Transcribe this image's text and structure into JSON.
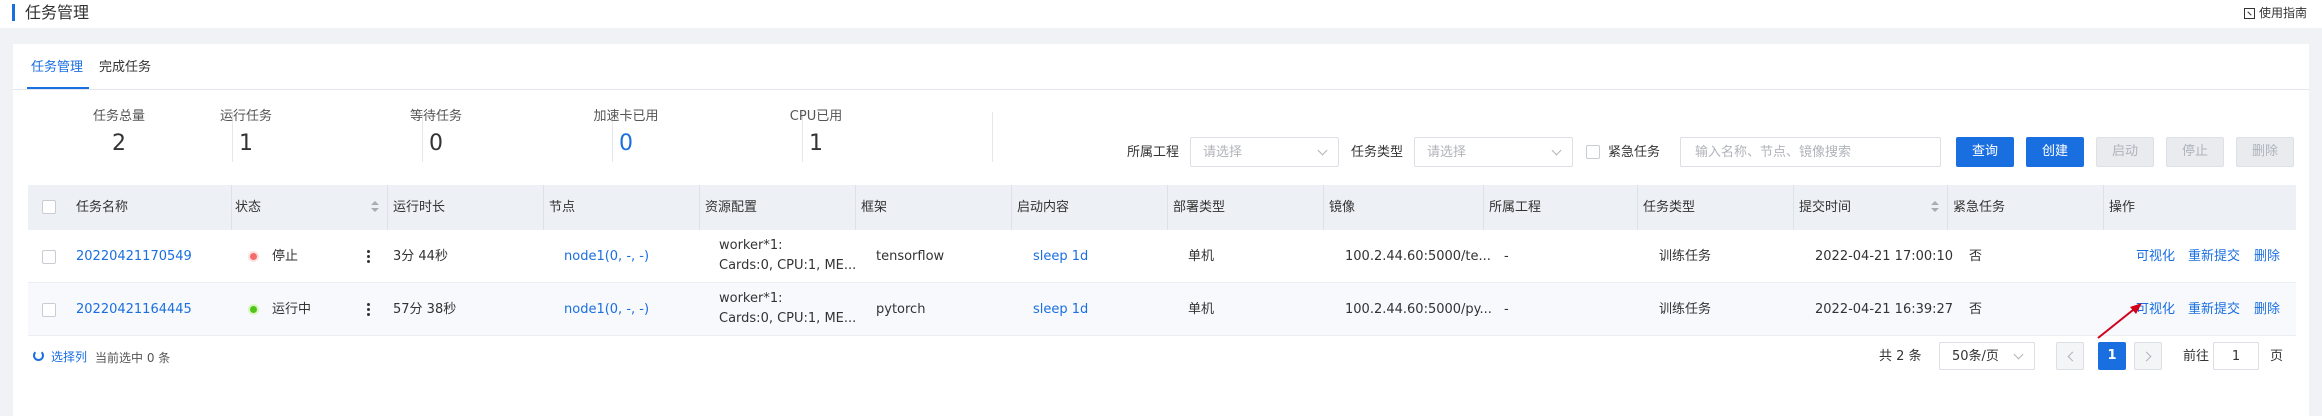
{
  "header": {
    "title": "任务管理",
    "guide_label": "使用指南"
  },
  "tabs": [
    {
      "label": "任务管理",
      "active": true
    },
    {
      "label": "完成任务",
      "active": false
    }
  ],
  "stats": [
    {
      "label": "任务总量",
      "value": "2"
    },
    {
      "label": "运行任务",
      "value": "1"
    },
    {
      "label": "等待任务",
      "value": "0"
    },
    {
      "label": "加速卡已用",
      "value": "0"
    },
    {
      "label": "CPU已用",
      "value": "1"
    }
  ],
  "filters": {
    "project_label": "所属工程",
    "project_placeholder": "请选择",
    "type_label": "任务类型",
    "type_placeholder": "请选择",
    "urgent_label": "紧急任务",
    "search_placeholder": "输入名称、节点、镜像搜索"
  },
  "buttons": {
    "query": "查询",
    "create": "创建",
    "start": "启动",
    "stop": "停止",
    "delete": "删除"
  },
  "table": {
    "columns": [
      "任务名称",
      "状态",
      "运行时长",
      "节点",
      "资源配置",
      "框架",
      "启动内容",
      "部署类型",
      "镜像",
      "所属工程",
      "任务类型",
      "提交时间",
      "紧急任务",
      "操作"
    ],
    "rows": [
      {
        "name": "20220421170549",
        "status": "停止",
        "duration": "3分 44秒",
        "node": "node1(0, -, -)",
        "res_line1": "worker*1:",
        "res_line2": "Cards:0, CPU:1, ME...",
        "framework": "tensorflow",
        "start_content": "sleep 1d",
        "deploy_type": "单机",
        "image": "100.2.44.60:5000/te...",
        "project": "-",
        "task_type": "训练任务",
        "submit_time": "2022-04-21 17:00:10",
        "urgent": "否",
        "actions": [
          "可视化",
          "重新提交",
          "删除"
        ]
      },
      {
        "name": "20220421164445",
        "status": "运行中",
        "duration": "57分 38秒",
        "node": "node1(0, -, -)",
        "res_line1": "worker*1:",
        "res_line2": "Cards:0, CPU:1, ME...",
        "framework": "pytorch",
        "start_content": "sleep 1d",
        "deploy_type": "单机",
        "image": "100.2.44.60:5000/py...",
        "project": "-",
        "task_type": "训练任务",
        "submit_time": "2022-04-21 16:39:27",
        "urgent": "否",
        "actions": [
          "可视化",
          "重新提交",
          "删除"
        ]
      }
    ]
  },
  "footer": {
    "select_cols": "选择列",
    "selected_text": "当前选中 0 条",
    "total_text": "共 2 条",
    "page_size": "50条/页",
    "current_page": "1",
    "goto_prefix": "前往",
    "goto_value": "1",
    "goto_suffix": "页"
  },
  "colors": {
    "accent": "#1a6fe0",
    "stopped": "#f56c6c",
    "running": "#52c41a",
    "annotation_arrow": "#d0021b"
  }
}
